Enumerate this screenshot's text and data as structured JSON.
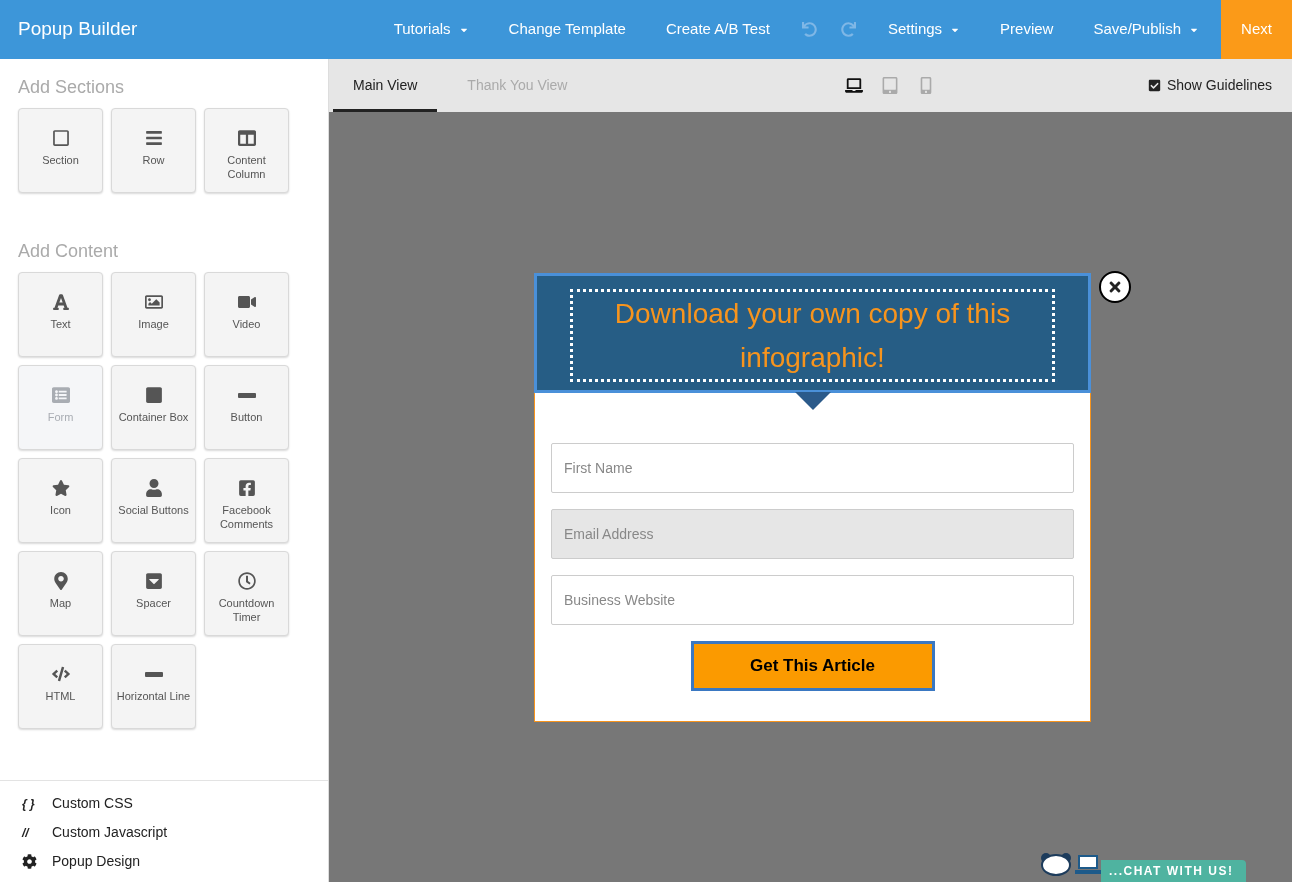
{
  "app": {
    "title": "Popup Builder"
  },
  "nav": [
    {
      "label": "Tutorials",
      "kind": "dropdown",
      "disabled": false
    },
    {
      "label": "Change Template",
      "kind": "link",
      "disabled": false
    },
    {
      "label": "Create A/B Test",
      "kind": "link",
      "disabled": false
    },
    {
      "kind": "undo",
      "disabled": true
    },
    {
      "kind": "redo",
      "disabled": true
    },
    {
      "label": "Settings",
      "kind": "dropdown",
      "disabled": false
    },
    {
      "label": "Preview",
      "kind": "link",
      "disabled": false
    },
    {
      "label": "Save/Publish",
      "kind": "dropdown",
      "disabled": false
    }
  ],
  "next_button": "Next",
  "sidebar": {
    "sections": [
      {
        "title": "Add Sections",
        "items": [
          {
            "label": "Section",
            "disabled": false
          },
          {
            "label": "Row",
            "disabled": false
          },
          {
            "label": "Content Column",
            "disabled": false
          }
        ]
      },
      {
        "title": "Add Content",
        "items": [
          {
            "label": "Text",
            "disabled": false
          },
          {
            "label": "Image",
            "disabled": false
          },
          {
            "label": "Video",
            "disabled": false
          },
          {
            "label": "Form",
            "disabled": true
          },
          {
            "label": "Container Box",
            "disabled": false
          },
          {
            "label": "Button",
            "disabled": false
          },
          {
            "label": "Icon",
            "disabled": false
          },
          {
            "label": "Social Buttons",
            "disabled": false
          },
          {
            "label": "Facebook Comments",
            "disabled": false
          },
          {
            "label": "Map",
            "disabled": false
          },
          {
            "label": "Spacer",
            "disabled": false
          },
          {
            "label": "Countdown Timer",
            "disabled": false
          },
          {
            "label": "HTML",
            "disabled": false
          },
          {
            "label": "Horizontal Line",
            "disabled": false
          }
        ]
      }
    ],
    "footer_links": [
      {
        "glyph": "{ }",
        "label": "Custom CSS",
        "kind": "glyph"
      },
      {
        "glyph": "//",
        "label": "Custom Javascript",
        "kind": "glyph"
      },
      {
        "label": "Popup Design",
        "kind": "gear"
      }
    ]
  },
  "view_tabs": [
    {
      "label": "Main View",
      "selected": true
    },
    {
      "label": "Thank You View",
      "selected": false
    }
  ],
  "devices": [
    {
      "kind": "desktop",
      "selected": true
    },
    {
      "kind": "tablet",
      "selected": false
    },
    {
      "kind": "phone",
      "selected": false
    }
  ],
  "guidelines": {
    "label": "Show Guidelines",
    "checked": true
  },
  "popup": {
    "headline": "Download your own copy of this infographic!",
    "fields": [
      {
        "placeholder": "First Name",
        "highlighted": false
      },
      {
        "placeholder": "Email Address",
        "highlighted": true
      },
      {
        "placeholder": "Business Website",
        "highlighted": false
      }
    ],
    "submit": "Get This Article"
  },
  "chat": {
    "label": "...CHAT WITH US!"
  }
}
